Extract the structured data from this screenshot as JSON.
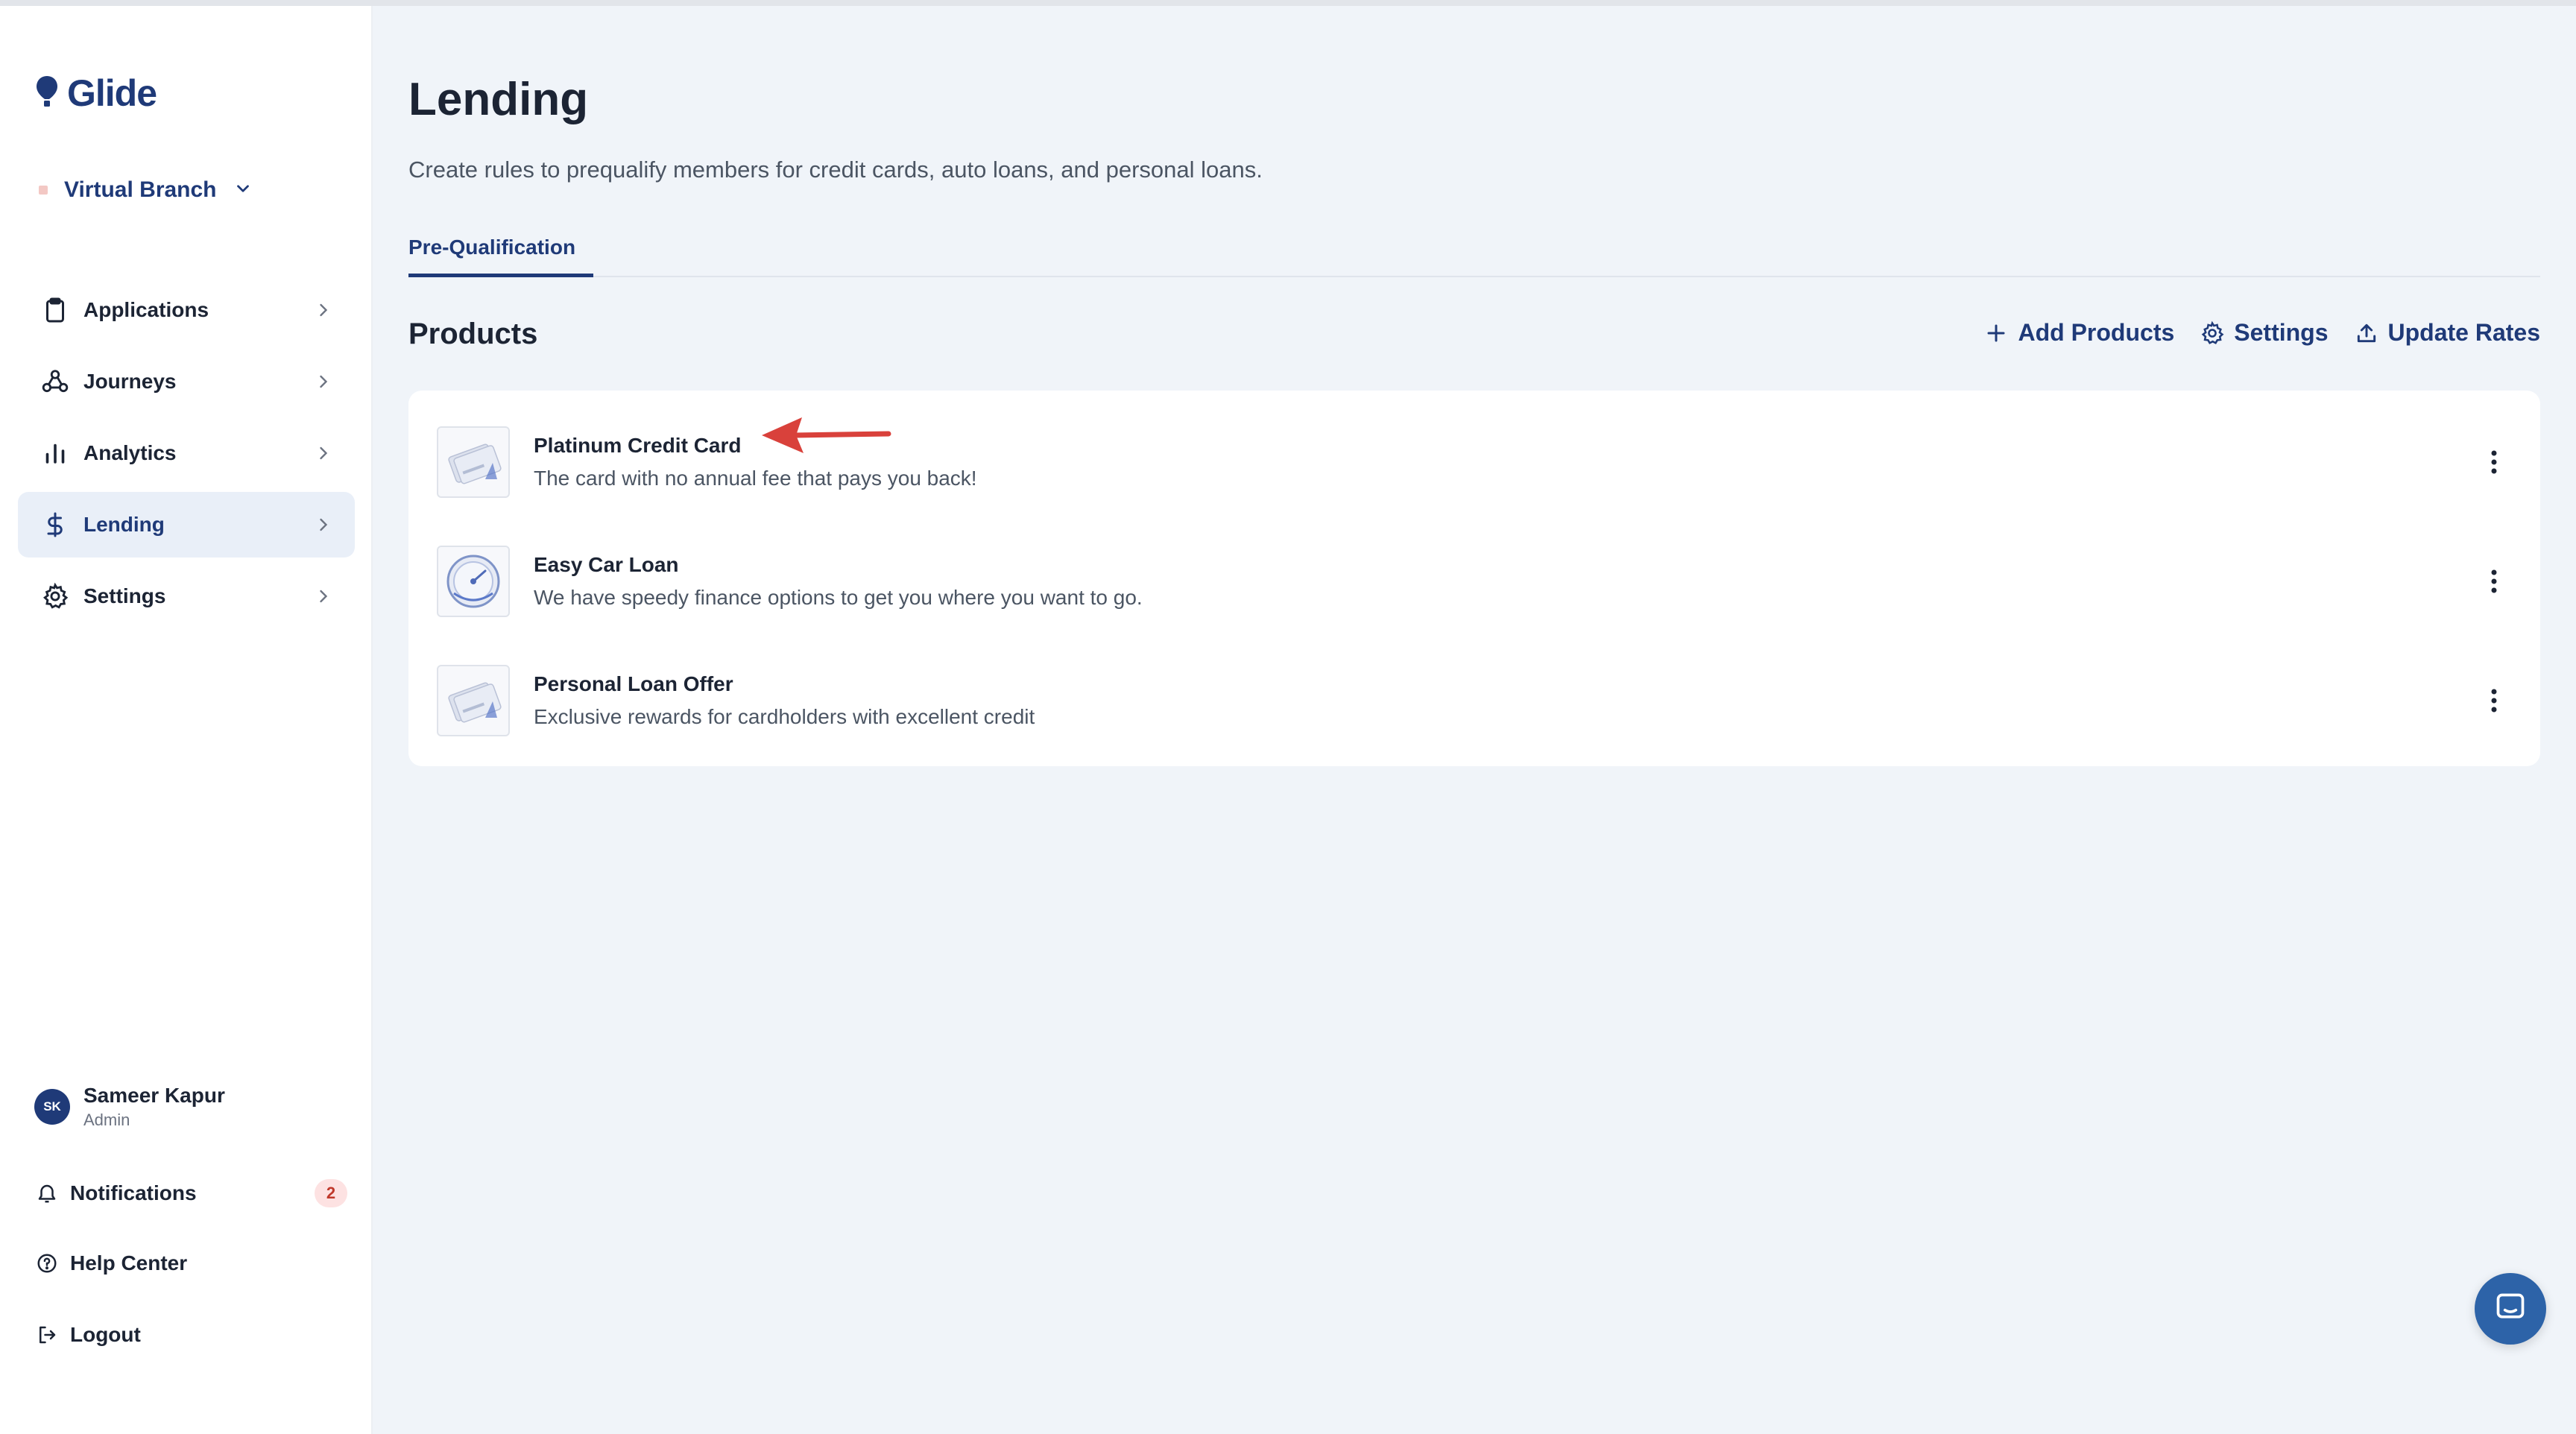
{
  "brand": {
    "name": "Glide",
    "color": "#1f3a78"
  },
  "branch": {
    "label": "Virtual Branch"
  },
  "sidebar": {
    "items": [
      {
        "label": "Applications",
        "icon": "clipboard-icon"
      },
      {
        "label": "Journeys",
        "icon": "journeys-icon"
      },
      {
        "label": "Analytics",
        "icon": "bar-chart-icon"
      },
      {
        "label": "Lending",
        "icon": "dollar-icon",
        "active": true
      },
      {
        "label": "Settings",
        "icon": "gear-icon"
      }
    ]
  },
  "user": {
    "initials": "SK",
    "name": "Sameer Kapur",
    "role": "Admin"
  },
  "bottom_nav": {
    "notifications": {
      "label": "Notifications",
      "count": "2"
    },
    "help": {
      "label": "Help Center"
    },
    "logout": {
      "label": "Logout"
    }
  },
  "page": {
    "title": "Lending",
    "subtitle": "Create rules to prequalify members for credit cards, auto loans, and personal loans.",
    "tabs": [
      {
        "label": "Pre-Qualification",
        "active": true
      }
    ]
  },
  "products_section": {
    "title": "Products",
    "actions": {
      "add": "Add Products",
      "settings": "Settings",
      "update": "Update Rates"
    },
    "items": [
      {
        "name": "Platinum Credit Card",
        "description": "The card with no annual fee that pays you back!",
        "thumb": "credit-card-thumbnail"
      },
      {
        "name": "Easy Car Loan",
        "description": "We have speedy finance options to get you where you want to go.",
        "thumb": "speedometer-thumbnail"
      },
      {
        "name": "Personal Loan Offer",
        "description": "Exclusive rewards for cardholders with excellent credit",
        "thumb": "credit-card-thumbnail"
      }
    ]
  },
  "annotation": {
    "arrow_color": "#d9413b"
  }
}
